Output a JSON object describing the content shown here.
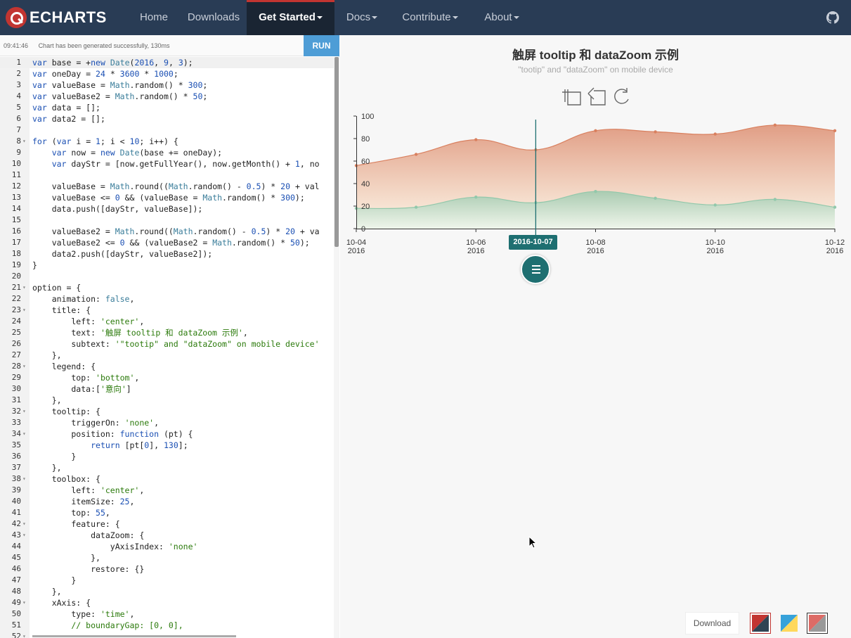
{
  "navbar": {
    "logo_text": "ECHARTS",
    "items": [
      {
        "label": "Home"
      },
      {
        "label": "Downloads"
      },
      {
        "label": "Get Started",
        "active": true
      },
      {
        "label": "Docs"
      },
      {
        "label": "Contribute"
      },
      {
        "label": "About"
      }
    ],
    "github_icon": "github-icon",
    "colors": {
      "bar": "#293c55",
      "active": "#1a2533",
      "accent": "#c23531"
    }
  },
  "editor": {
    "status_time": "09:41:46",
    "status_message": "Chart has been generated successfully, 130ms",
    "run_label": "RUN",
    "code": [
      {
        "n": "1",
        "t": "var base = +new Date(2016, 9, 3);"
      },
      {
        "n": "2",
        "t": "var oneDay = 24 * 3600 * 1000;"
      },
      {
        "n": "3",
        "t": "var valueBase = Math.random() * 300;"
      },
      {
        "n": "4",
        "t": "var valueBase2 = Math.random() * 50;"
      },
      {
        "n": "5",
        "t": "var data = [];"
      },
      {
        "n": "6",
        "t": "var data2 = [];"
      },
      {
        "n": "7",
        "t": ""
      },
      {
        "n": "8",
        "t": "for (var i = 1; i < 10; i++) {",
        "fold": true
      },
      {
        "n": "9",
        "t": "    var now = new Date(base += oneDay);"
      },
      {
        "n": "10",
        "t": "    var dayStr = [now.getFullYear(), now.getMonth() + 1, no"
      },
      {
        "n": "11",
        "t": ""
      },
      {
        "n": "12",
        "t": "    valueBase = Math.round((Math.random() - 0.5) * 20 + val"
      },
      {
        "n": "13",
        "t": "    valueBase <= 0 && (valueBase = Math.random() * 300);"
      },
      {
        "n": "14",
        "t": "    data.push([dayStr, valueBase]);"
      },
      {
        "n": "15",
        "t": ""
      },
      {
        "n": "16",
        "t": "    valueBase2 = Math.round((Math.random() - 0.5) * 20 + va"
      },
      {
        "n": "17",
        "t": "    valueBase2 <= 0 && (valueBase2 = Math.random() * 50);"
      },
      {
        "n": "18",
        "t": "    data2.push([dayStr, valueBase2]);"
      },
      {
        "n": "19",
        "t": "}"
      },
      {
        "n": "20",
        "t": ""
      },
      {
        "n": "21",
        "t": "option = {",
        "fold": true
      },
      {
        "n": "22",
        "t": "    animation: false,"
      },
      {
        "n": "23",
        "t": "    title: {",
        "fold": true
      },
      {
        "n": "24",
        "t": "        left: 'center',"
      },
      {
        "n": "25",
        "t": "        text: '触屏 tooltip 和 dataZoom 示例',"
      },
      {
        "n": "26",
        "t": "        subtext: '\"tootip\" and \"dataZoom\" on mobile device'"
      },
      {
        "n": "27",
        "t": "    },"
      },
      {
        "n": "28",
        "t": "    legend: {",
        "fold": true
      },
      {
        "n": "29",
        "t": "        top: 'bottom',"
      },
      {
        "n": "30",
        "t": "        data:['意向']"
      },
      {
        "n": "31",
        "t": "    },"
      },
      {
        "n": "32",
        "t": "    tooltip: {",
        "fold": true
      },
      {
        "n": "33",
        "t": "        triggerOn: 'none',"
      },
      {
        "n": "34",
        "t": "        position: function (pt) {",
        "fold": true
      },
      {
        "n": "35",
        "t": "            return [pt[0], 130];"
      },
      {
        "n": "36",
        "t": "        }"
      },
      {
        "n": "37",
        "t": "    },"
      },
      {
        "n": "38",
        "t": "    toolbox: {",
        "fold": true
      },
      {
        "n": "39",
        "t": "        left: 'center',"
      },
      {
        "n": "40",
        "t": "        itemSize: 25,"
      },
      {
        "n": "41",
        "t": "        top: 55,"
      },
      {
        "n": "42",
        "t": "        feature: {",
        "fold": true
      },
      {
        "n": "43",
        "t": "            dataZoom: {",
        "fold": true
      },
      {
        "n": "44",
        "t": "                yAxisIndex: 'none'"
      },
      {
        "n": "45",
        "t": "            },"
      },
      {
        "n": "46",
        "t": "            restore: {}"
      },
      {
        "n": "47",
        "t": "        }"
      },
      {
        "n": "48",
        "t": "    },"
      },
      {
        "n": "49",
        "t": "    xAxis: {",
        "fold": true
      },
      {
        "n": "50",
        "t": "        type: 'time',"
      },
      {
        "n": "51",
        "t": "        // boundaryGap: [0, 0],"
      },
      {
        "n": "52",
        "t": "",
        "fold": true
      }
    ]
  },
  "chart": {
    "title": "触屏 tooltip 和 dataZoom 示例",
    "subtitle": "\"tootip\" and \"dataZoom\" on mobile device",
    "toolbox": [
      "zoom-icon",
      "zoom-back-icon",
      "restore-icon"
    ],
    "tooltip_date": "2016-10-07",
    "download_label": "Download",
    "themes": [
      "theme-default",
      "theme-light",
      "theme-dark"
    ]
  },
  "chart_data": {
    "type": "area",
    "title": "触屏 tooltip 和 dataZoom 示例",
    "subtitle": "\"tootip\" and \"dataZoom\" on mobile device",
    "x": [
      "2016-10-04",
      "2016-10-05",
      "2016-10-06",
      "2016-10-07",
      "2016-10-08",
      "2016-10-09",
      "2016-10-10",
      "2016-10-11",
      "2016-10-12"
    ],
    "x_tick_labels": [
      [
        "10-04",
        "2016"
      ],
      [
        "10-06",
        "2016"
      ],
      [
        "10-08",
        "2016"
      ],
      [
        "10-10",
        "2016"
      ],
      [
        "10-12",
        "2016"
      ]
    ],
    "ylim": [
      0,
      100
    ],
    "y_ticks": [
      "0",
      "20",
      "40",
      "60",
      "80",
      "100"
    ],
    "series": [
      {
        "values": [
          56,
          66,
          79,
          70,
          87,
          86,
          84,
          92,
          87
        ],
        "color": "#d9805f"
      },
      {
        "values": [
          18,
          19,
          28,
          23,
          33,
          27,
          21,
          26,
          19
        ],
        "color": "#92c8ab"
      }
    ],
    "tooltip_x": "2016-10-07",
    "grid": false
  }
}
